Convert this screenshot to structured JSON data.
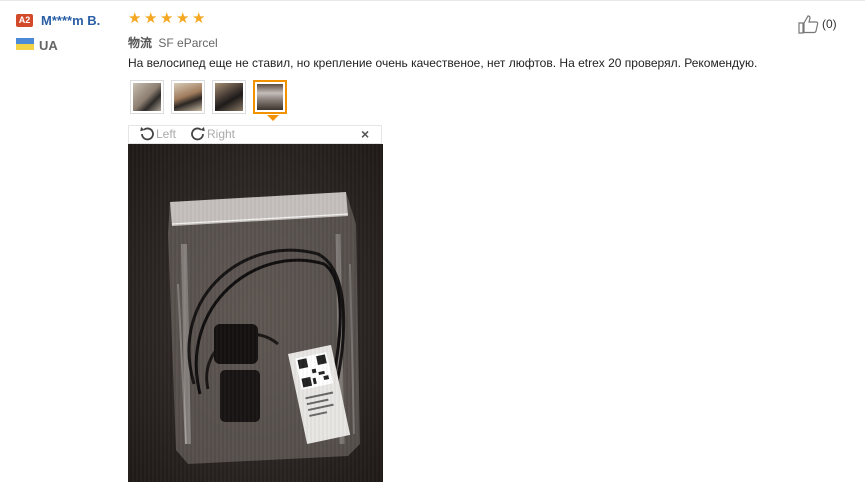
{
  "user": {
    "level_badge": "A2",
    "name": "M****m B.",
    "country": "UA"
  },
  "rating": {
    "stars": 5
  },
  "shipping": {
    "label": "物流",
    "carrier": "SF eParcel"
  },
  "review": {
    "text": "На велосипед еще не ставил, но крепление очень качественое, нет люфтов. На etrex 20 проверял. Рекомендую."
  },
  "helpful": {
    "count": "(0)"
  },
  "viewer": {
    "rotate_left_label": "Left",
    "rotate_right_label": "Right",
    "close_label": "×"
  },
  "thumbnails": {
    "count": 4,
    "active_index": 4
  },
  "colors": {
    "accent": "#f39200",
    "star": "#f5a623",
    "username": "#2a5fa6",
    "badge": "#d24a2a"
  }
}
